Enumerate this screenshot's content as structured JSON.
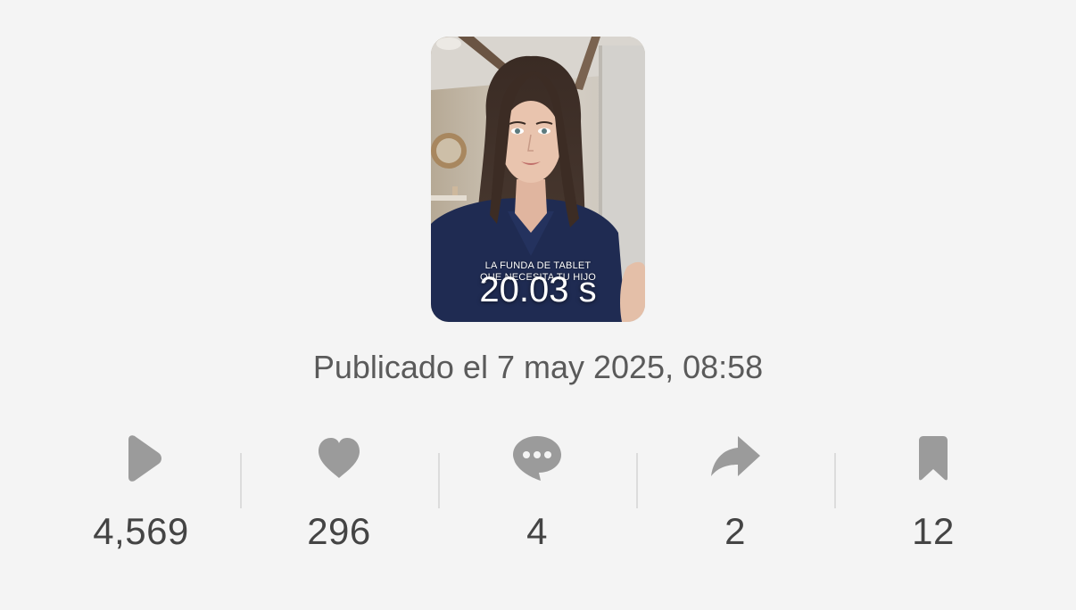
{
  "video": {
    "caption_line1": "LA FUNDA DE TABLET",
    "caption_line2": "QUE NECESITA TU HIJO",
    "duration": "20.03 s"
  },
  "published_label": "Publicado el 7 may 2025, 08:58",
  "stats": {
    "views": "4,569",
    "likes": "296",
    "comments": "4",
    "shares": "2",
    "saves": "12"
  },
  "colors": {
    "background": "#f4f4f4",
    "icon": "#9b9b9b",
    "value_text": "#444444",
    "published_text": "#5a5a5a"
  }
}
